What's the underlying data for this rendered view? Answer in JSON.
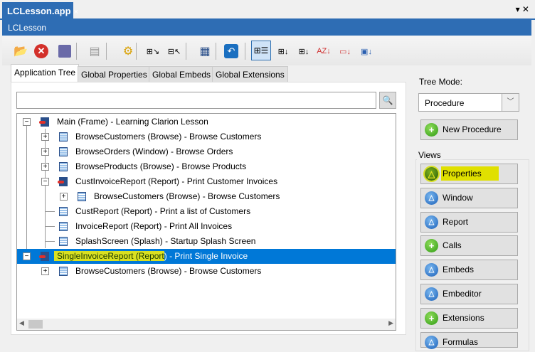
{
  "doc_tab": {
    "label": "LCLesson.app",
    "close": "×"
  },
  "window_controls": "▾ ✕",
  "title": "LCLesson",
  "toolbar": [
    "open-icon",
    "close-red-icon",
    "save-icon",
    "print-preview-icon",
    "generate-icon",
    "expand-all-icon",
    "contract-all-icon",
    "properties-icon",
    "undo-icon",
    "tree-view-icon",
    "sort-icon",
    "sort-2-icon",
    "sort-az-icon",
    "sort-category-icon",
    "sort-module-icon"
  ],
  "tabs": [
    "Application Tree",
    "Global Properties",
    "Global Embeds",
    "Global Extensions"
  ],
  "search": {
    "value": "",
    "icon": "🔍"
  },
  "tree": [
    {
      "level": 0,
      "toggle": "−",
      "icon": "frame",
      "text": "Main (Frame) - Learning Clarion Lesson"
    },
    {
      "level": 1,
      "toggle": "+",
      "icon": "doc",
      "text": "BrowseCustomers (Browse) - Browse Customers"
    },
    {
      "level": 1,
      "toggle": "+",
      "icon": "doc",
      "text": "BrowseOrders (Window) - Browse Orders"
    },
    {
      "level": 1,
      "toggle": "+",
      "icon": "doc",
      "text": "BrowseProducts (Browse) - Browse Products"
    },
    {
      "level": 1,
      "toggle": "−",
      "icon": "frame",
      "text": "CustInvoiceReport (Report) - Print Customer Invoices"
    },
    {
      "level": 2,
      "toggle": "+",
      "icon": "doc",
      "text": "BrowseCustomers (Browse) - Browse Customers"
    },
    {
      "level": 1,
      "toggle": "",
      "icon": "doc",
      "text": "CustReport (Report) - Print a list of Customers"
    },
    {
      "level": 1,
      "toggle": "",
      "icon": "doc",
      "text": "InvoiceReport (Report) - Print All Invoices"
    },
    {
      "level": 1,
      "toggle": "",
      "icon": "doc",
      "text": "SplashScreen (Splash) - Startup Splash Screen"
    },
    {
      "level": 0,
      "toggle": "−",
      "icon": "frame",
      "text": "SingleInvoiceReport (Report) - Print Single Invoice",
      "selected": true,
      "highlight": "SingleInvoiceReport (Report",
      "rest": ") - Print Single Invoice"
    },
    {
      "level": 1,
      "toggle": "+",
      "icon": "doc",
      "text": "BrowseCustomers (Browse) - Browse Customers"
    }
  ],
  "tree_mode": {
    "label": "Tree Mode:",
    "value": "Procedure"
  },
  "new_procedure": "New Procedure",
  "views": {
    "label": "Views",
    "buttons": [
      {
        "label": "Properties",
        "color": "g",
        "glyph": "△",
        "highlight": true
      },
      {
        "label": "Window",
        "color": "b",
        "glyph": "△"
      },
      {
        "label": "Report",
        "color": "b",
        "glyph": "△"
      },
      {
        "label": "Calls",
        "color": "g",
        "glyph": "+"
      },
      {
        "label": "Embeds",
        "color": "b",
        "glyph": "△"
      },
      {
        "label": "Embeditor",
        "color": "b",
        "glyph": "△"
      },
      {
        "label": "Extensions",
        "color": "g",
        "glyph": "+"
      },
      {
        "label": "Formulas",
        "color": "b",
        "glyph": "△"
      }
    ]
  }
}
